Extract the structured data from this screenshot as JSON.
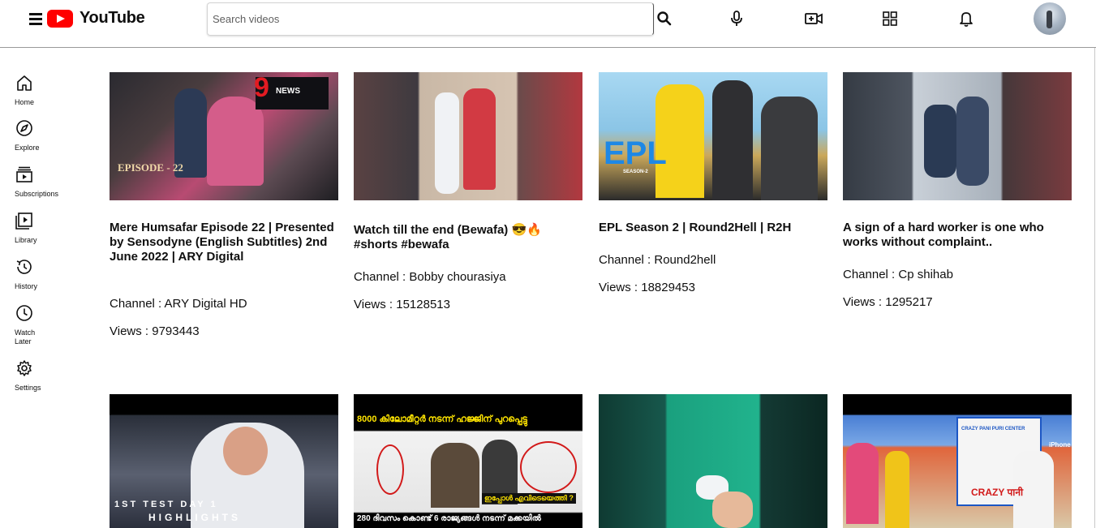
{
  "header": {
    "brand": "YouTube",
    "search_placeholder": "Search videos",
    "icons": [
      "menu-icon",
      "search-icon",
      "microphone-icon",
      "create-video-icon",
      "apps-grid-icon",
      "notifications-bell-icon",
      "avatar"
    ]
  },
  "sidebar": {
    "items": [
      {
        "label": "Home",
        "icon": "home-icon"
      },
      {
        "label": "Explore",
        "icon": "compass-icon"
      },
      {
        "label": "Subscriptions",
        "icon": "subscriptions-icon"
      },
      {
        "label": "Library",
        "icon": "library-icon"
      },
      {
        "label": "History",
        "icon": "history-icon"
      },
      {
        "label": "Watch Later",
        "icon": "clock-icon"
      },
      {
        "label": "Settings",
        "icon": "gear-icon"
      }
    ]
  },
  "videos": [
    {
      "title": "Mere Humsafar Episode 22 | Presented by Sensodyne (English Subtitles) 2nd June 2022 | ARY Digital",
      "channel": "Channel : ARY Digital HD",
      "views": "Views : 9793443",
      "thumb_text": "EPISODE - 22",
      "thumb_logo": "9",
      "thumb_logo_sub": "NEWS"
    },
    {
      "title": "Watch till the end (Bewafa) 😎🔥 #shorts #bewafa",
      "channel": "Channel : Bobby chourasiya",
      "views": "Views : 15128513"
    },
    {
      "title": "EPL Season 2 | Round2Hell | R2H",
      "channel": "Channel : Round2hell",
      "views": "Views : 18829453",
      "thumb_text": "EPL",
      "thumb_sub": "SEASON-2"
    },
    {
      "title": "A sign of a hard worker is one who works without complaint..",
      "channel": "Channel : Cp shihab",
      "views": "Views : 1295217"
    },
    {
      "title": "",
      "channel": "",
      "views": "",
      "thumb_text": "1ST TEST DAY 1",
      "thumb_sub": "HIGHLIGHTS"
    },
    {
      "title": "",
      "channel": "",
      "views": "",
      "thumb_text": "8000 കിലോമീറ്റർ നടന്ന് ഹജ്ജിന് പുറപ്പെട്ടു",
      "thumb_sub": "280 ദിവസം കൊണ്ട് 6 രാജ്യങ്ങൾ നടന്ന് മക്കയിൽ",
      "thumb_badge": "ഇപ്പോൾ എവിടെയെത്തി ?"
    },
    {
      "title": "",
      "channel": "",
      "views": ""
    },
    {
      "title": "",
      "channel": "",
      "views": "",
      "thumb_text": "CRAZY PANI PURI CENTER",
      "thumb_sub": "CRAZY पानी",
      "thumb_badge": "iPhone"
    }
  ]
}
